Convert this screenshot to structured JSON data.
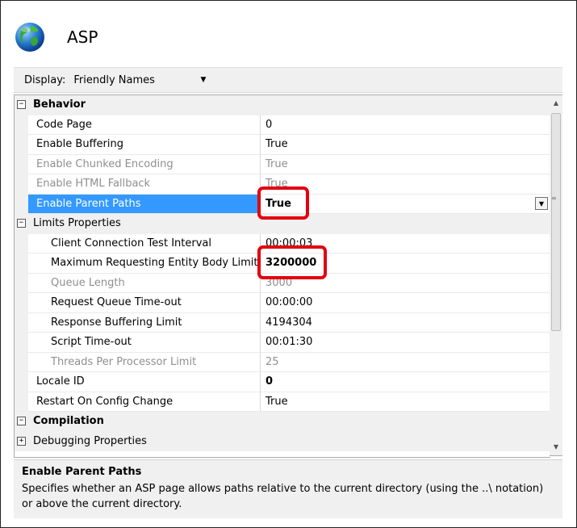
{
  "header": {
    "title": "ASP",
    "icon": "globe-icon"
  },
  "display": {
    "label": "Display:",
    "value": "Friendly Names"
  },
  "properties": [
    {
      "kind": "category",
      "toggle": "⊟",
      "name": "Behavior",
      "bold": true
    },
    {
      "kind": "prop",
      "name": "Code Page",
      "value": "0"
    },
    {
      "kind": "prop",
      "name": "Enable Buffering",
      "value": "True"
    },
    {
      "kind": "prop",
      "name": "Enable Chunked Encoding",
      "value": "True",
      "disabled": true
    },
    {
      "kind": "prop",
      "name": "Enable HTML Fallback",
      "value": "True",
      "disabled": true
    },
    {
      "kind": "prop",
      "name": "Enable Parent Paths",
      "value": "True",
      "selected": true,
      "highlighted": true
    },
    {
      "kind": "subcategory",
      "toggle": "⊟",
      "name": "Limits Properties"
    },
    {
      "kind": "prop",
      "level": 2,
      "name": "Client Connection Test Interval",
      "value": "00:00:03"
    },
    {
      "kind": "prop",
      "level": 2,
      "name": "Maximum Requesting Entity Body Limit",
      "value": "3200000",
      "bold": true,
      "highlighted": true
    },
    {
      "kind": "prop",
      "level": 2,
      "name": "Queue Length",
      "value": "3000",
      "disabled": true
    },
    {
      "kind": "prop",
      "level": 2,
      "name": "Request Queue Time-out",
      "value": "00:00:00"
    },
    {
      "kind": "prop",
      "level": 2,
      "name": "Response Buffering Limit",
      "value": "4194304"
    },
    {
      "kind": "prop",
      "level": 2,
      "name": "Script Time-out",
      "value": "00:01:30"
    },
    {
      "kind": "prop",
      "level": 2,
      "name": "Threads Per Processor Limit",
      "value": "25",
      "disabled": true
    },
    {
      "kind": "prop",
      "name": "Locale ID",
      "value": "0",
      "bold": true
    },
    {
      "kind": "prop",
      "name": "Restart On Config Change",
      "value": "True"
    },
    {
      "kind": "category",
      "toggle": "⊟",
      "name": "Compilation",
      "bold": true
    },
    {
      "kind": "subcategory",
      "toggle": "⊞",
      "name": "Debugging Properties"
    }
  ],
  "description": {
    "title": "Enable Parent Paths",
    "text": "Specifies whether an ASP page allows paths relative to the current directory (using the ..\\ notation) or above the current directory."
  },
  "colors": {
    "selection": "#3399ff",
    "highlight_box": "#e3000f",
    "category_bg": "#f0f0f0"
  }
}
